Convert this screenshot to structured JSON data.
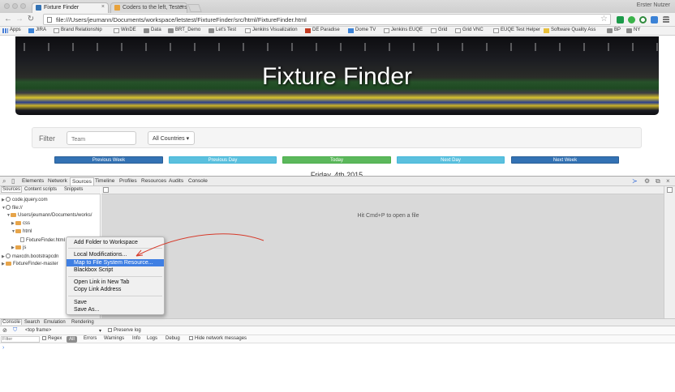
{
  "browser": {
    "tabs": [
      {
        "title": "Fixture Finder",
        "active": true,
        "favicon_color": "#3372b4"
      },
      {
        "title": "Coders to the left, Testers",
        "active": false,
        "favicon_color": "#e8a23b"
      }
    ],
    "close_glyph": "×",
    "user_name": "Erster Nutzer",
    "url": "file:///Users/jeumann/Documents/workspace/letstest/FixtureFinder/src/html/FixtureFinder.html",
    "nav_icons": [
      "back-icon",
      "forward-icon",
      "reload-icon"
    ],
    "nav_glyphs": {
      "back": "←",
      "forward": "→",
      "reload": "↻"
    },
    "star_glyph": "☆",
    "extensions": [
      {
        "name": "extension-gtm-icon",
        "color": "#1c9a4a"
      },
      {
        "name": "extension-green-icon",
        "color": "#3bb34a"
      },
      {
        "name": "extension-circle-icon",
        "color": "#2e8a3c"
      },
      {
        "name": "extension-blue-icon",
        "color": "#3b82d6"
      },
      {
        "name": "menu-icon",
        "color": "#777777"
      }
    ]
  },
  "bookmarks": [
    {
      "label": "Apps",
      "icon": "apps"
    },
    {
      "label": "JIRA",
      "icon": "blue"
    },
    {
      "label": "Brand Relationship",
      "icon": "page"
    },
    {
      "label": "WinDE",
      "icon": "page"
    },
    {
      "label": "Data",
      "icon": "folder"
    },
    {
      "label": "BRT_Demo",
      "icon": "folder"
    },
    {
      "label": "Let's Test",
      "icon": "folder"
    },
    {
      "label": "Jenkins Visualization",
      "icon": "page"
    },
    {
      "label": "DE Paradise",
      "icon": "red"
    },
    {
      "label": "Dome TV",
      "icon": "blue"
    },
    {
      "label": "Jenkins EUQE",
      "icon": "page"
    },
    {
      "label": "Grid",
      "icon": "page"
    },
    {
      "label": "Grid VNC",
      "icon": "page"
    },
    {
      "label": "EUQE Test Helper",
      "icon": "page"
    },
    {
      "label": "Software Quality Ass",
      "icon": "yellow"
    },
    {
      "label": "BP",
      "icon": "folder"
    },
    {
      "label": "NY",
      "icon": "folder"
    }
  ],
  "page": {
    "title": "Fixture Finder",
    "filter_label": "Filter",
    "team_placeholder": "Team",
    "countries_selected": "All Countries ▾",
    "nav_buttons": [
      {
        "label": "Previous Week",
        "style": "primary"
      },
      {
        "label": "Previous Day",
        "style": "info"
      },
      {
        "label": "Today",
        "style": "success"
      },
      {
        "label": "Next Day",
        "style": "info"
      },
      {
        "label": "Next Week",
        "style": "primary"
      }
    ],
    "date_text": "Friday, 4th 2015"
  },
  "devtools": {
    "tabs": [
      "Elements",
      "Network",
      "Sources",
      "Timeline",
      "Profiles",
      "Resources",
      "Audits",
      "Console"
    ],
    "active_tab": "Sources",
    "icon_glyphs": {
      "inspect": "⌕",
      "device": "▯",
      "console_drawer": "≻",
      "settings": "⚙",
      "dock": "⧉",
      "close": "×"
    },
    "navigator_tabs": [
      "Sources",
      "Content scripts",
      "Snippets"
    ],
    "tree": [
      {
        "label": "code.jquery.com",
        "type": "cloud",
        "indent": 0,
        "tri": "▶"
      },
      {
        "label": "file://",
        "type": "cloud",
        "indent": 0,
        "tri": "▼"
      },
      {
        "label": "Users/jeumann/Documents/works/",
        "type": "folder",
        "indent": 1,
        "tri": "▼"
      },
      {
        "label": "css",
        "type": "folder",
        "indent": 2,
        "tri": "▶"
      },
      {
        "label": "html",
        "type": "folder",
        "indent": 2,
        "tri": "▼"
      },
      {
        "label": "FixtureFinder.html",
        "type": "file",
        "indent": 3,
        "tri": ""
      },
      {
        "label": "js",
        "type": "folder",
        "indent": 2,
        "tri": "▶"
      },
      {
        "label": "maxcdn.bootstrapcdn",
        "type": "cloud",
        "indent": 0,
        "tri": "▶"
      },
      {
        "label": "FixtureFinder-master",
        "type": "folder",
        "indent": 0,
        "tri": "▶"
      }
    ],
    "editor_hint": "Hit Cmd+P to open a file",
    "context_menu": [
      {
        "label": "Add Folder to Workspace",
        "highlighted": false
      },
      {
        "label": "Local Modifications...",
        "highlighted": false
      },
      {
        "label": "Map to File System Resource...",
        "highlighted": true
      },
      {
        "label": "Blackbox Script",
        "highlighted": false
      },
      {
        "label": "Open Link in New Tab",
        "highlighted": false
      },
      {
        "label": "Copy Link Address",
        "highlighted": false
      },
      {
        "label": "Save",
        "highlighted": false
      },
      {
        "label": "Save As...",
        "highlighted": false
      }
    ],
    "drawer_tabs": [
      "Console",
      "Search",
      "Emulation",
      "Rendering"
    ],
    "console": {
      "clear_glyph": "⊘",
      "filter_glyph": "⛉",
      "frame": "<top frame>",
      "frame_caret": "▾",
      "preserve_log": "Preserve log",
      "filter_placeholder": "Filter",
      "regex": "Regex",
      "levels": [
        "All",
        "Errors",
        "Warnings",
        "Info",
        "Logs",
        "Debug"
      ],
      "hide_network": "Hide network messages",
      "prompt": "›"
    }
  }
}
